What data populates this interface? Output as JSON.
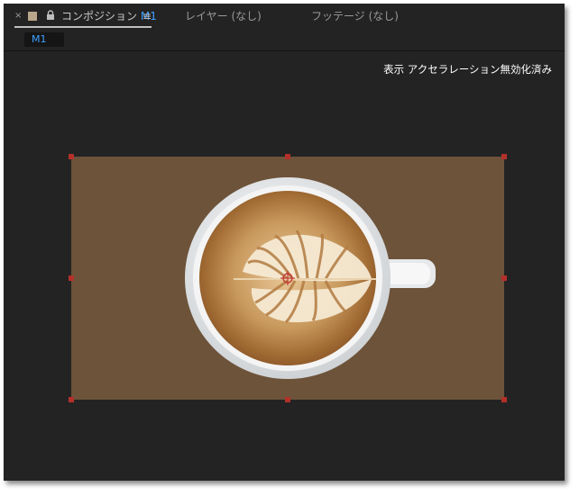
{
  "tabs": {
    "close_glyph": "×",
    "composition_prefix": "コンポジション",
    "composition_name": "M1",
    "menu_glyph": "≡",
    "layer_tab": "レイヤー (なし)",
    "footage_tab": "フッテージ (なし)"
  },
  "breadcrumb": {
    "label": "M1"
  },
  "viewer": {
    "notice": "表示 アクセラレーション無効化済み"
  },
  "icons": {
    "close": "close-icon",
    "swatch": "label-color-icon",
    "lock": "lock-icon",
    "menu": "panel-menu-icon",
    "anchor": "anchor-point-icon"
  },
  "colors": {
    "panel_bg": "#232323",
    "accent_blue": "#3fa0ff",
    "comp_bg": "#6c533a",
    "handle_red": "#b3302a",
    "label_swatch": "#b9a58a"
  }
}
